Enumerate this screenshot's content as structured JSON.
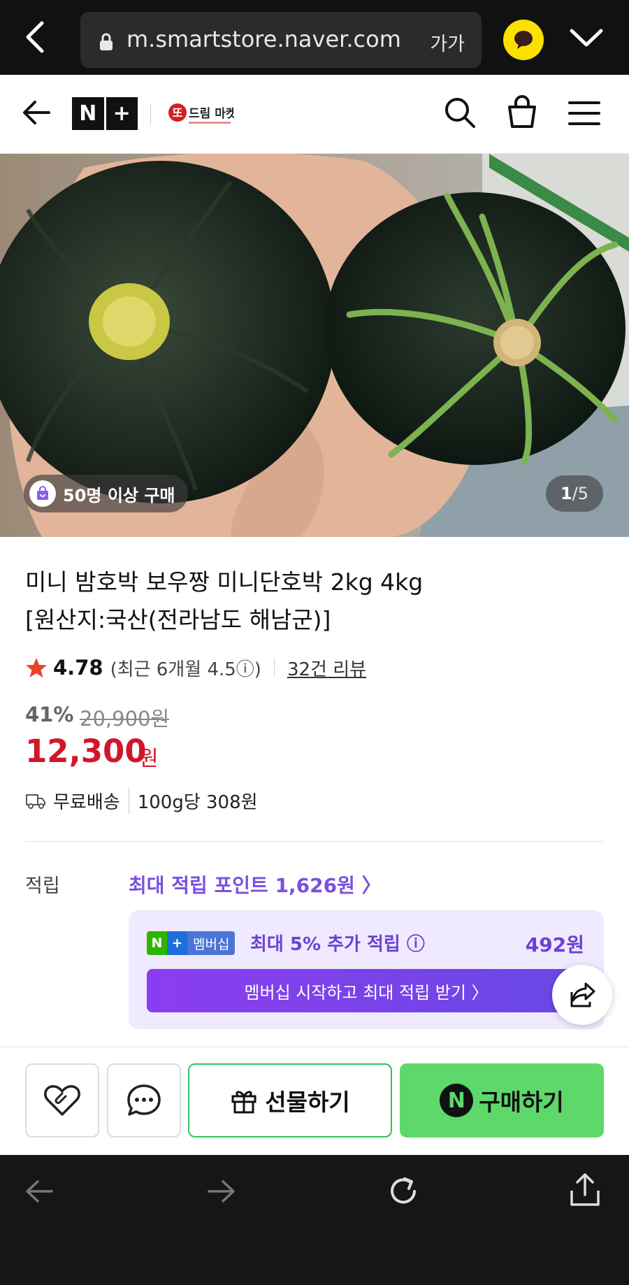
{
  "browser": {
    "url": "m.smartstore.naver.com",
    "text_size_label": "가가"
  },
  "header": {
    "nplus_left": "N",
    "nplus_right": "+",
    "store_logo_text": "또드림 마켓"
  },
  "gallery": {
    "purchase_badge": "50명 이상 구매",
    "current": "1",
    "total": "/5"
  },
  "product": {
    "title_line1": "미니 밤호박 보우짱 미니단호박 2kg 4kg",
    "title_line2": "[원산지:국산(전라남도 해남군)]",
    "rating": "4.78",
    "recent_rating": "(최근 6개월 4.5ⓘ)",
    "review_link": "32건 리뷰",
    "discount": "41%",
    "original_price": "20,900원",
    "price": "12,300",
    "price_unit": "원",
    "shipping": "무료배송",
    "unit_price": "100g당 308원"
  },
  "points": {
    "label": "적립",
    "max_points": "최대 적립 포인트 1,626원 〉",
    "membership_badge_n": "N",
    "membership_badge_plus": "+",
    "membership_badge_text": "멤버십",
    "membership_extra": "최대 5% 추가 적립 ⓘ",
    "membership_amount": "492원",
    "membership_button": "멤버십 시작하고 최대 적립 받기 〉"
  },
  "actions": {
    "gift": "선물하기",
    "buy_n": "N",
    "buy": "구매하기"
  },
  "colors": {
    "price_red": "#d1162b",
    "points_purple": "#7b4fe0",
    "buy_green": "#5ed86a",
    "kakao_yellow": "#fae100"
  }
}
